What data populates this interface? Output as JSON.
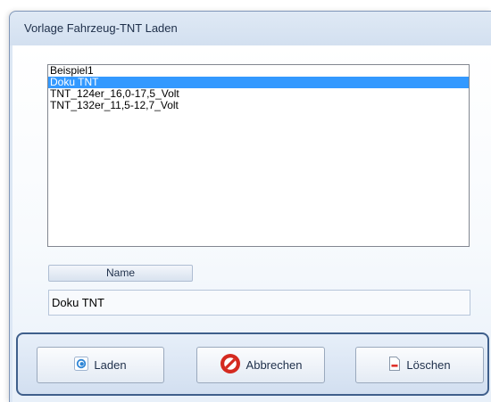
{
  "window": {
    "title": "Vorlage Fahrzeug-TNT  Laden"
  },
  "list": {
    "items": [
      "Beispiel1",
      "Doku TNT",
      "TNT_124er_16,0-17,5_Volt",
      "TNT_132er_11,5-12,7_Volt"
    ],
    "selected_index": 1,
    "selection_color": "#3399ff"
  },
  "name_section": {
    "header_label": "Name",
    "value": "Doku TNT"
  },
  "buttons": {
    "load": {
      "label": "Laden",
      "icon": "load-icon"
    },
    "cancel": {
      "label": "Abbrechen",
      "icon": "cancel-icon"
    },
    "delete": {
      "label": "Löschen",
      "icon": "delete-icon"
    }
  },
  "colors": {
    "title_bar": "#d3e0f0",
    "group_border": "#3f5f8b"
  }
}
